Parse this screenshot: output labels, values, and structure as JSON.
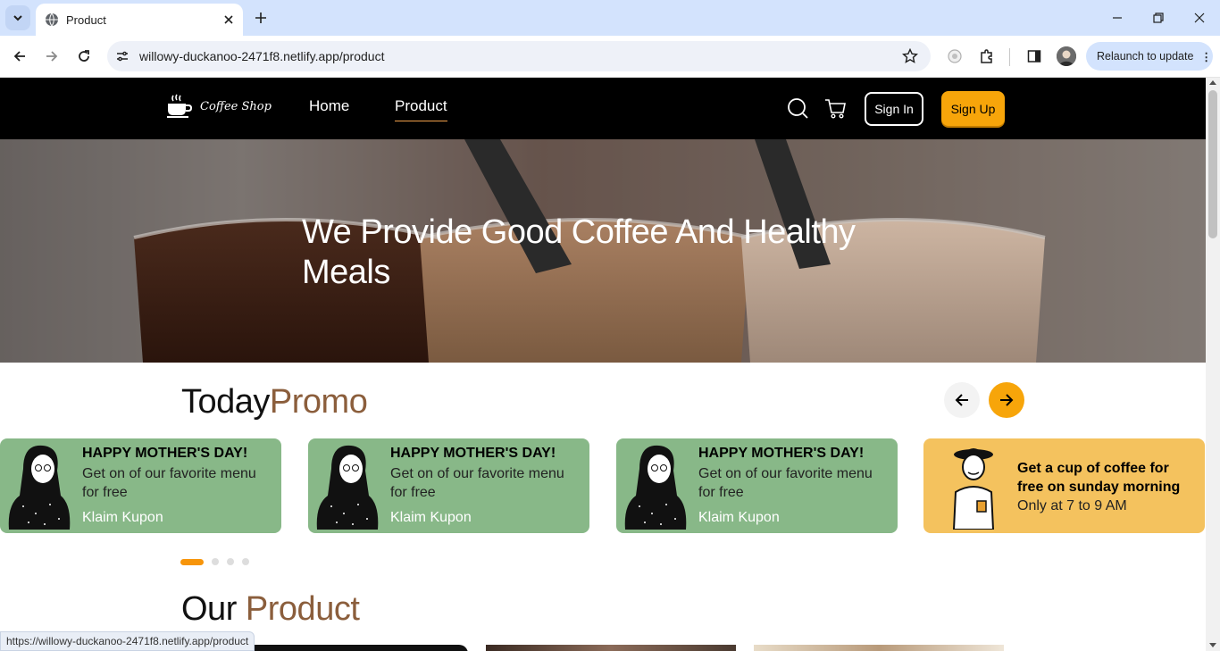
{
  "browser": {
    "tab_title": "Product",
    "url": "willowy-duckanoo-2471f8.netlify.app/product",
    "relaunch_label": "Relaunch to update",
    "status_url": "https://willowy-duckanoo-2471f8.netlify.app/product"
  },
  "site": {
    "logo_text": "Coffee Shop",
    "nav": {
      "home": "Home",
      "product": "Product"
    },
    "sign_in": "Sign In",
    "sign_up": "Sign Up"
  },
  "hero": {
    "title": "We Provide Good Coffee And Healthy Meals"
  },
  "promo": {
    "title_main": "Today",
    "title_accent": "Promo",
    "cards": [
      {
        "title": "HAPPY MOTHER'S DAY!",
        "desc": "Get on of our favorite menu for free",
        "link": "Klaim Kupon"
      },
      {
        "title": "HAPPY MOTHER'S DAY!",
        "desc": "Get on of our favorite menu for free",
        "link": "Klaim Kupon"
      },
      {
        "title": "HAPPY MOTHER'S DAY!",
        "desc": "Get on of our favorite menu for free",
        "link": "Klaim Kupon"
      },
      {
        "title": "Get a cup of coffee for free on sunday morning",
        "desc": "Only at 7 to 9 AM"
      }
    ]
  },
  "product_section": {
    "title_main": "Our",
    "title_accent": "Product"
  },
  "colors": {
    "accent": "#f7a50a",
    "brown": "#8b5e3c",
    "card_green": "#88b888",
    "card_yellow": "#f4c25e"
  }
}
